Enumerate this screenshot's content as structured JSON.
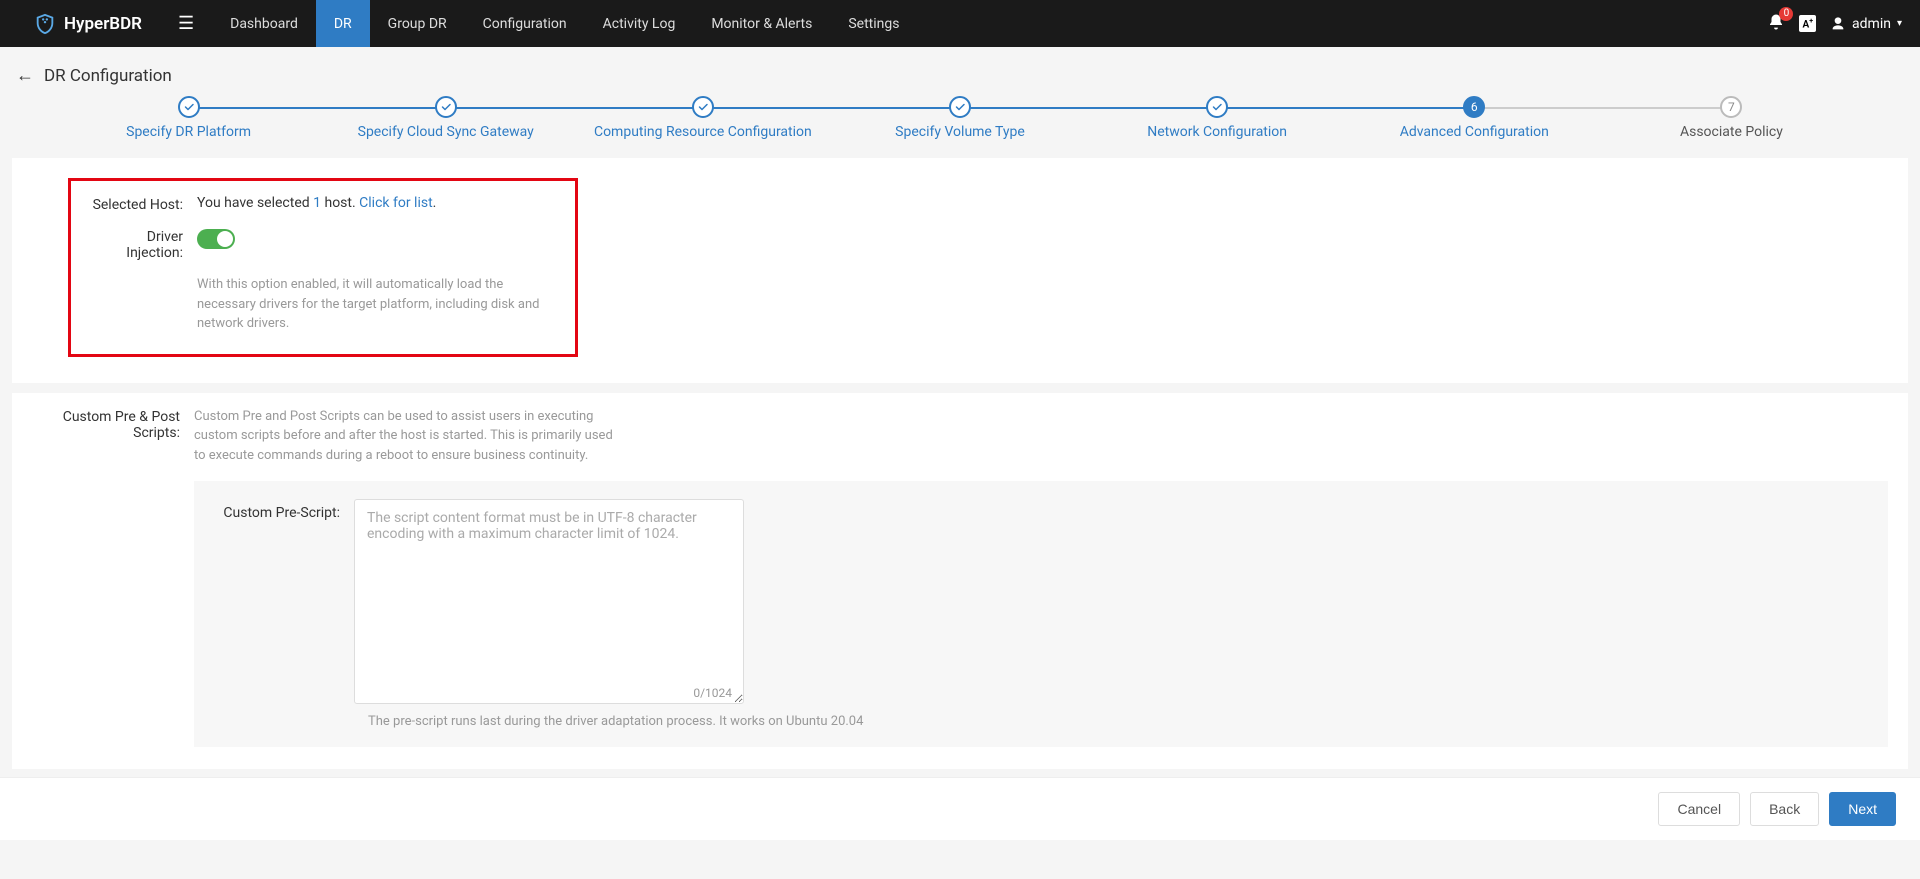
{
  "brand": "HyperBDR",
  "nav": {
    "items": [
      "Dashboard",
      "DR",
      "Group DR",
      "Configuration",
      "Activity Log",
      "Monitor & Alerts",
      "Settings"
    ],
    "active_index": 1
  },
  "notifications": {
    "count": "0"
  },
  "lang_badge": "A",
  "user": {
    "name": "admin"
  },
  "page": {
    "title": "DR Configuration"
  },
  "stepper": {
    "steps": [
      {
        "label": "Specify DR Platform",
        "state": "done"
      },
      {
        "label": "Specify Cloud Sync Gateway",
        "state": "done"
      },
      {
        "label": "Computing Resource Configuration",
        "state": "done"
      },
      {
        "label": "Specify Volume Type",
        "state": "done"
      },
      {
        "label": "Network Configuration",
        "state": "done"
      },
      {
        "label": "Advanced Configuration",
        "state": "current",
        "num": "6"
      },
      {
        "label": "Associate Policy",
        "state": "future",
        "num": "7"
      }
    ]
  },
  "selected_host": {
    "label": "Selected Host:",
    "prefix": "You have selected ",
    "count": "1",
    "mid": " host. ",
    "link": "Click for list",
    "suffix": "."
  },
  "driver_injection": {
    "label": "Driver Injection:",
    "enabled": true,
    "help": "With this option enabled, it will automatically load the necessary drivers for the target platform, including disk and network drivers."
  },
  "scripts": {
    "section_label": "Custom Pre & Post Scripts:",
    "section_help": "Custom Pre and Post Scripts can be used to assist users in executing custom scripts before and after the host is started. This is primarily used to execute commands during a reboot to ensure business continuity.",
    "pre": {
      "label": "Custom Pre-Script:",
      "placeholder": "The script content format must be in UTF-8 character encoding with a maximum character limit of 1024.",
      "value": "",
      "counter": "0/1024",
      "help": "The pre-script runs last during the driver adaptation process. It works on Ubuntu 20.04"
    }
  },
  "footer": {
    "cancel": "Cancel",
    "back": "Back",
    "next": "Next"
  }
}
